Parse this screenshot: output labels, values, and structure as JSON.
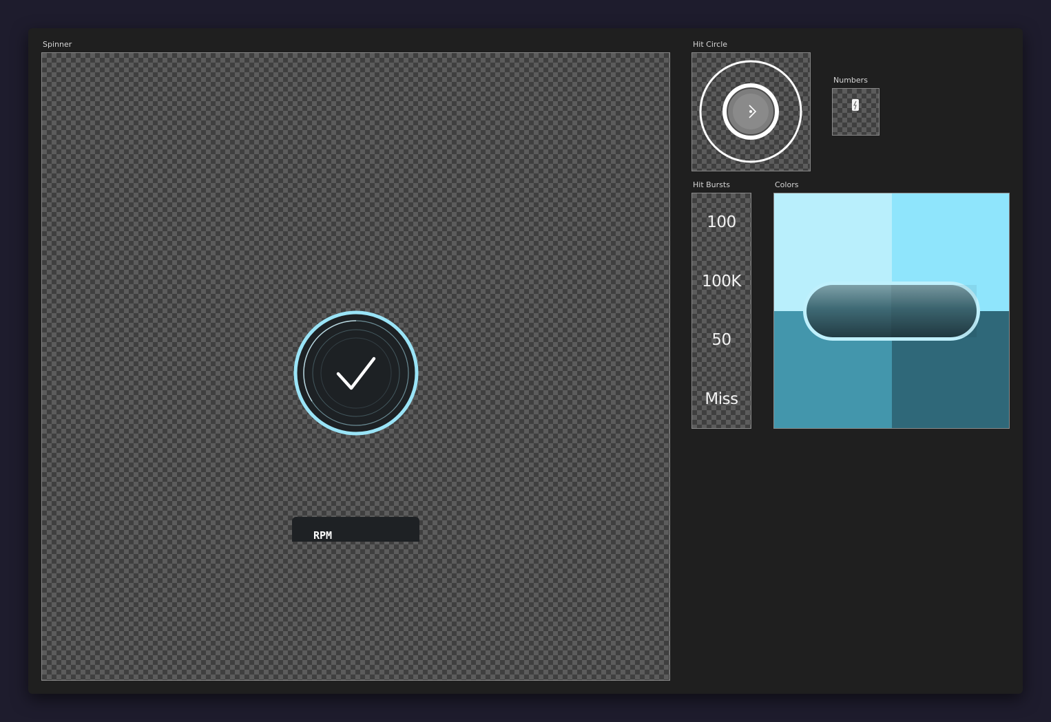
{
  "sections": {
    "spinner": "Spinner",
    "hit_circle": "Hit Circle",
    "numbers": "Numbers",
    "hit_bursts": "Hit Bursts",
    "colors": "Colors"
  },
  "spinner": {
    "rpm_label": "RPM",
    "center_icon": "checkmark-icon",
    "accent_color": "#9ae4f7",
    "disc_color": "#1d2124"
  },
  "hit_circle": {
    "center_icon": "chevron-right-icon"
  },
  "numbers": {
    "icon": "numeral-glyph-icon"
  },
  "hit_bursts": {
    "items": [
      "100",
      "100K",
      "50",
      "Miss"
    ]
  },
  "colors": {
    "swatches": [
      "#b9effc",
      "#8fe5fc",
      "#4396ac",
      "#2f6879"
    ],
    "pill_border_color": "#bff0fc",
    "pill_fill_color": "#3f6a75"
  }
}
